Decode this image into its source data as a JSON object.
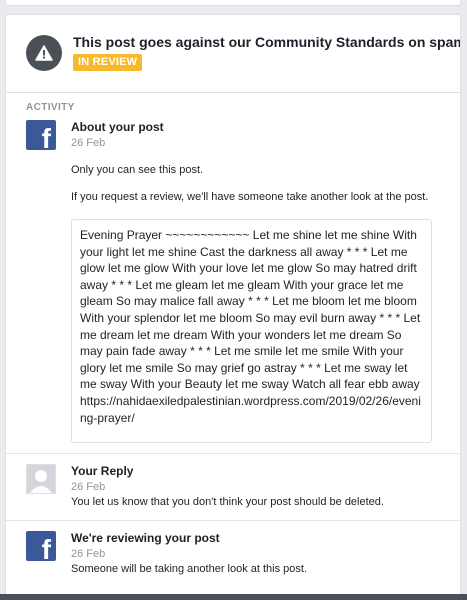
{
  "header": {
    "title": "This post goes against our Community Standards on spam",
    "badge": "IN REVIEW"
  },
  "activity": {
    "label": "ACTIVITY",
    "items": [
      {
        "title": "About your post",
        "date": "26 Feb",
        "text1": "Only you can see this post.",
        "text2": "If you request a review, we'll have someone take another look at the post.",
        "quote": "Evening Prayer ~~~~~~~~~~~~ Let me shine let me shine With your light let me shine Cast the darkness all away * * * Let me glow let me glow With your love let me glow So may hatred drift away * * * Let me gleam let me gleam With your grace let me gleam So may malice fall away * * * Let me bloom let me bloom With your splendor let me bloom So may evil burn away * * * Let me dream let me dream With your wonders let me dream So may pain fade away * * * Let me smile let me smile With your glory let me smile So may grief go astray * * * Let me sway let me sway With your Beauty let me sway Watch all fear ebb away https://nahidaexiledpalestinian.wordpress.com/2019/02/26/evening-prayer/"
      },
      {
        "title": "Your Reply",
        "date": "26 Feb",
        "text": "You let us know that you don't think your post should be deleted."
      },
      {
        "title": "We're reviewing your post",
        "date": "26 Feb",
        "text": "Someone will be taking another look at this post."
      }
    ]
  },
  "colors": {
    "facebook_blue": "#3b5998",
    "badge_yellow": "#f7b928",
    "warning_grey": "#4b4f56"
  },
  "icons": {
    "header": "warning-icon",
    "item_app": "facebook-icon",
    "item_user": "avatar-placeholder"
  }
}
